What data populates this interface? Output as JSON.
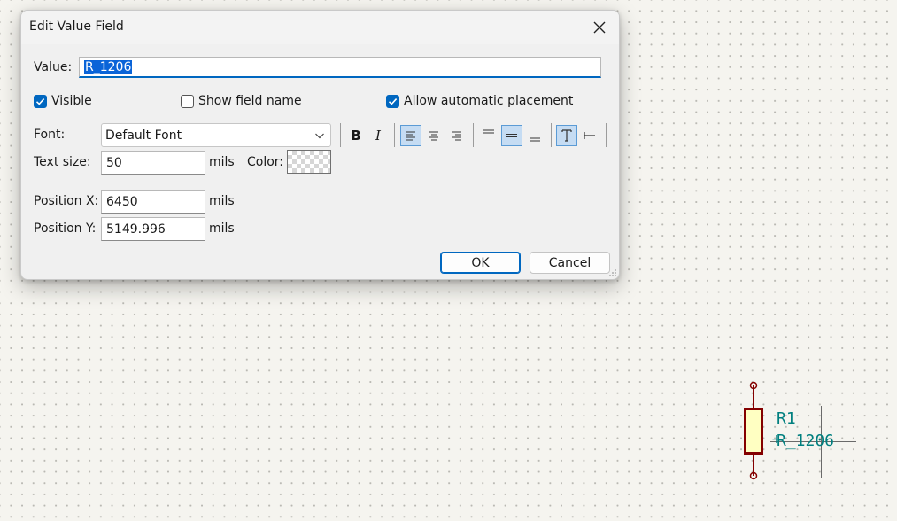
{
  "dialog": {
    "title": "Edit Value Field",
    "value_label": "Value:",
    "value_text": "R_1206",
    "visible_label": "Visible",
    "visible_checked": true,
    "show_field_name_label": "Show field name",
    "show_field_name_checked": false,
    "auto_place_label": "Allow automatic placement",
    "auto_place_checked": true,
    "font_label": "Font:",
    "font_value": "Default Font",
    "text_size_label": "Text size:",
    "text_size_value": "50",
    "text_size_unit": "mils",
    "color_label": "Color:",
    "pos_x_label": "Position X:",
    "pos_x_value": "6450",
    "pos_x_unit": "mils",
    "pos_y_label": "Position Y:",
    "pos_y_value": "5149.996",
    "pos_y_unit": "mils",
    "ok_label": "OK",
    "cancel_label": "Cancel",
    "toolbar": {
      "bold_glyph": "B",
      "italic_glyph": "I",
      "icons": [
        "bold-icon",
        "italic-icon",
        "align-left-icon",
        "align-center-icon",
        "align-right-icon",
        "valign-top-icon",
        "valign-center-icon",
        "valign-bottom-icon",
        "orient-horizontal-icon",
        "orient-vertical-icon"
      ],
      "active": [
        "align-left-icon",
        "valign-center-icon",
        "orient-horizontal-icon"
      ]
    }
  },
  "schematic": {
    "ref": "R1",
    "value": "R_1206"
  },
  "colors": {
    "accent": "#0067c0",
    "selection": "#0a64d8",
    "toggle_on": "#c5dcf3",
    "canvas_bg": "#f5f4ef",
    "wire": "#840000",
    "body_fill": "#ffffc2",
    "field_text": "#007f7f"
  }
}
